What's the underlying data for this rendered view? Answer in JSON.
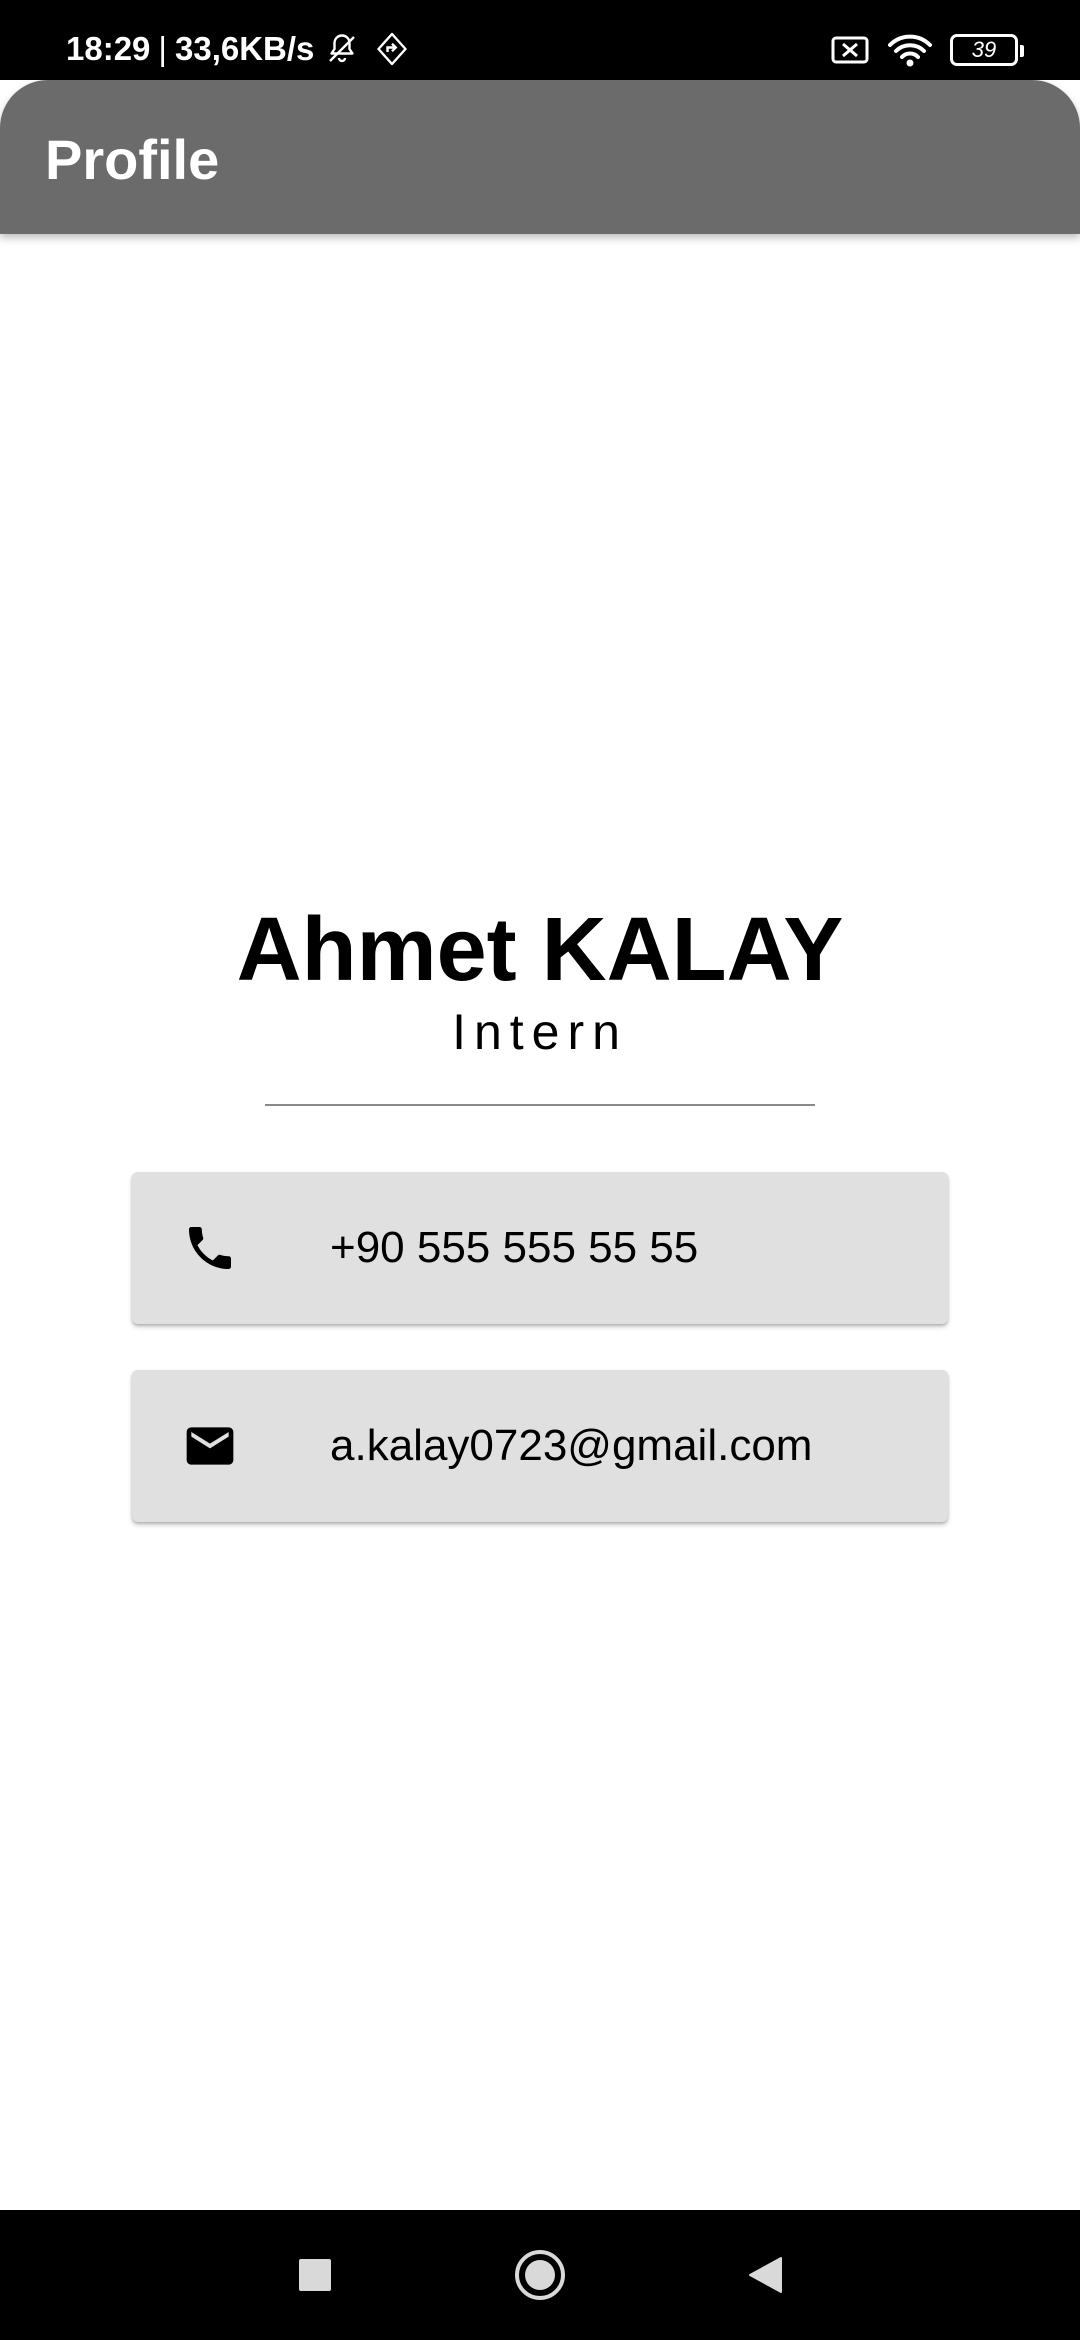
{
  "status_bar": {
    "time": "18:29",
    "separator": "|",
    "network_speed": "33,6KB/s",
    "battery_level": "39",
    "icons": [
      "bell-off-icon",
      "location-diamond-icon",
      "sim-off-icon",
      "wifi-icon",
      "battery-icon"
    ]
  },
  "app_bar": {
    "title": "Profile",
    "background_color": "#6b6b6b"
  },
  "profile": {
    "name": "Ahmet KALAY",
    "role": "Intern"
  },
  "contacts": {
    "phone": {
      "icon": "phone-icon",
      "value": "+90 555 555 55 55"
    },
    "email": {
      "icon": "mail-icon",
      "value": "a.kalay0723@gmail.com"
    },
    "card_color": "#e0e0e0"
  },
  "nav_bar": {
    "buttons": [
      "recents-button",
      "home-button",
      "back-button"
    ]
  }
}
